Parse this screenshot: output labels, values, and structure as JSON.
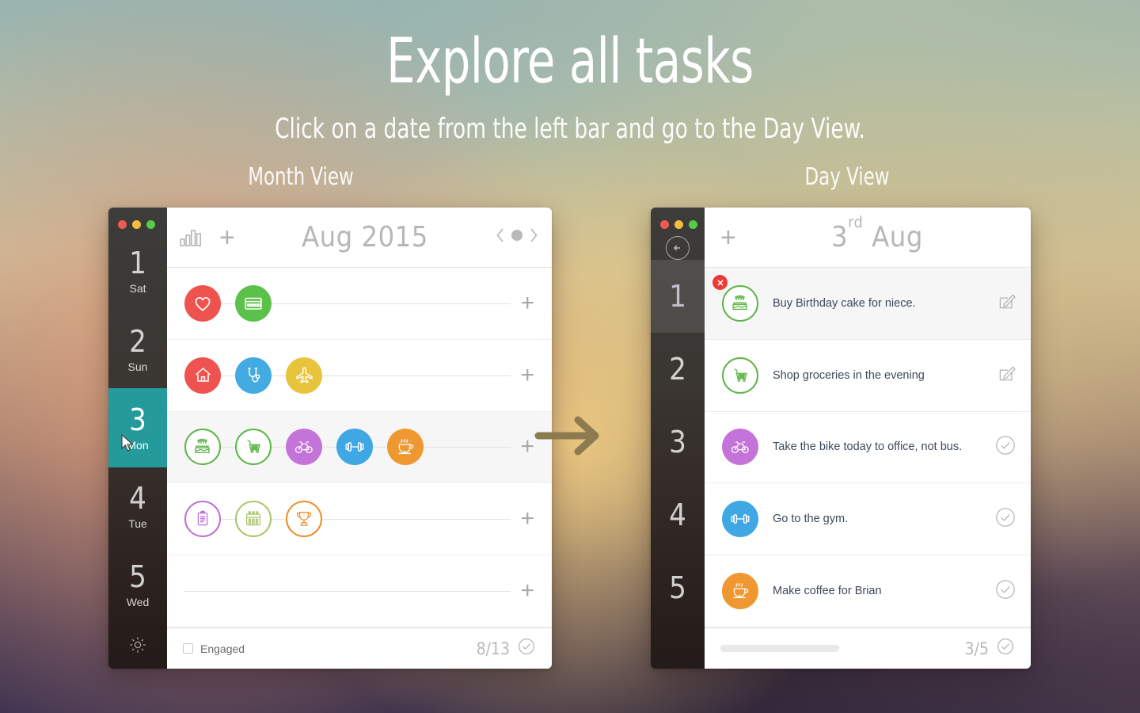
{
  "hero": {
    "title": "Explore all tasks",
    "subtitle": "Click on a date from the left bar and go to the Day View.",
    "label_left": "Month View",
    "label_right": "Day View"
  },
  "colors": {
    "accent_teal": "#249a9a",
    "red": "#ef5350",
    "green": "#5cc14a",
    "blue": "#44aae2",
    "yellow": "#e8c33c",
    "purple": "#c munchies",
    "orange": "#ef9831",
    "progress_blue": "#2f97e8",
    "badge_red": "#ef3b34"
  },
  "month_view": {
    "window_controls": [
      "close",
      "minimize",
      "maximize"
    ],
    "header": {
      "stats_icon": "bar-chart-icon",
      "add_label": "+",
      "title": "Aug 2015",
      "nav_prev": "chevron-left-icon",
      "nav_today": "dot-icon",
      "nav_next": "chevron-right-icon"
    },
    "sidebar": {
      "days": [
        {
          "num": "1",
          "dow": "Sat",
          "state": "normal"
        },
        {
          "num": "2",
          "dow": "Sun",
          "state": "normal"
        },
        {
          "num": "3",
          "dow": "Mon",
          "state": "active"
        },
        {
          "num": "4",
          "dow": "Tue",
          "state": "normal"
        },
        {
          "num": "5",
          "dow": "Wed",
          "state": "normal"
        }
      ],
      "settings_icon": "gear-icon"
    },
    "rows": [
      {
        "selected": false,
        "add_label": "+",
        "tasks": [
          {
            "icon": "heart-icon",
            "color": "#ef5350",
            "style": "filled"
          },
          {
            "icon": "credit-card-icon",
            "color": "#5cc14a",
            "style": "filled"
          }
        ]
      },
      {
        "selected": false,
        "add_label": "+",
        "tasks": [
          {
            "icon": "home-icon",
            "color": "#ef5350",
            "style": "filled"
          },
          {
            "icon": "stethoscope-icon",
            "color": "#44aae2",
            "style": "filled"
          },
          {
            "icon": "airplane-icon",
            "color": "#e8c33c",
            "style": "filled"
          }
        ]
      },
      {
        "selected": true,
        "add_label": "+",
        "tasks": [
          {
            "icon": "birthday-cake-icon",
            "color": "#5cb548",
            "style": "outline"
          },
          {
            "icon": "shopping-cart-icon",
            "color": "#5cb548",
            "style": "outline"
          },
          {
            "icon": "bicycle-icon",
            "color": "#c濃",
            "style": "filled"
          },
          {
            "icon": "dumbbell-icon",
            "color": "#3ea7e4",
            "style": "filled"
          },
          {
            "icon": "coffee-cup-icon",
            "color": "#ef9831",
            "style": "filled"
          }
        ]
      },
      {
        "selected": false,
        "add_label": "+",
        "tasks": [
          {
            "icon": "clipboard-icon",
            "color": "#bb6ed6",
            "style": "outline"
          },
          {
            "icon": "calendar-icon",
            "color": "#a8c56a",
            "style": "outline"
          },
          {
            "icon": "trophy-icon",
            "color": "#ee8c2a",
            "style": "outline"
          }
        ]
      },
      {
        "selected": false,
        "add_label": "+",
        "tasks": []
      }
    ],
    "footer": {
      "checkbox_label": "Engaged",
      "count": "8/13",
      "check_icon": "check-circle-icon"
    }
  },
  "day_view": {
    "window_controls": [
      "close",
      "minimize",
      "maximize"
    ],
    "header": {
      "back_icon": "arrow-left-circle-icon",
      "add_label": "+",
      "title_ordinal": "3",
      "title_suffix": "rd",
      "title_month": "Aug"
    },
    "sidebar": {
      "slots": [
        {
          "num": "1",
          "state": "highlight"
        },
        {
          "num": "2",
          "state": "normal"
        },
        {
          "num": "3",
          "state": "normal"
        },
        {
          "num": "4",
          "state": "normal"
        },
        {
          "num": "5",
          "state": "normal"
        }
      ]
    },
    "tasks": [
      {
        "text": "Buy Birthday cake for niece.",
        "icon": "birthday-cake-icon",
        "color": "#5cb548",
        "style": "outline",
        "action": "edit-icon",
        "selected": true,
        "badge": "x-badge"
      },
      {
        "text": "Shop groceries in the evening",
        "icon": "shopping-cart-icon",
        "color": "#5cb548",
        "style": "outline",
        "action": "edit-icon",
        "selected": false,
        "badge": null
      },
      {
        "text": "Take the bike today to office, not bus.",
        "icon": "bicycle-icon",
        "color": "#c474d8",
        "style": "filled",
        "action": "check-circle-icon",
        "selected": false,
        "badge": null
      },
      {
        "text": "Go to the gym.",
        "icon": "dumbbell-icon",
        "color": "#3ea7e4",
        "style": "filled",
        "action": "check-circle-icon",
        "selected": false,
        "badge": null
      },
      {
        "text": "Make coffee for Brian",
        "icon": "coffee-cup-icon",
        "color": "#ef9831",
        "style": "filled",
        "action": "check-circle-icon",
        "selected": false,
        "badge": null
      }
    ],
    "footer": {
      "progress_percent": 60,
      "count": "3/5",
      "check_icon": "check-circle-icon"
    }
  },
  "flow": {
    "arrow_icon": "arrow-right-icon",
    "arrow_color": "#8b7b4e"
  }
}
